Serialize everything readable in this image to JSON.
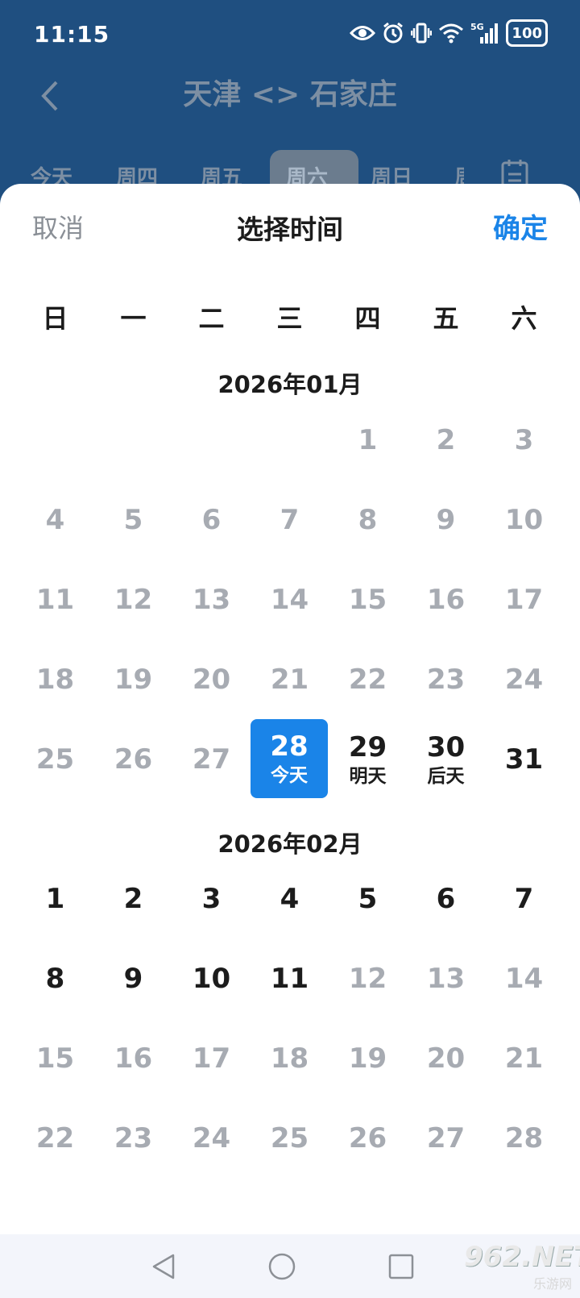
{
  "status_bar": {
    "time": "11:15",
    "signal_label": "5G",
    "battery": "100",
    "icons": [
      "eye-icon",
      "alarm-icon",
      "vibrate-icon",
      "wifi-icon",
      "signal-icon",
      "battery-icon"
    ]
  },
  "background": {
    "title": "天津 <> 石家庄",
    "tabs": [
      "今天",
      "周四",
      "周五",
      "周六",
      "周日",
      "周"
    ],
    "active_tab": "周六",
    "colors": {
      "header_bg": "#1f4f80"
    }
  },
  "sheet": {
    "cancel_label": "取消",
    "title": "选择时间",
    "confirm_label": "确定",
    "weekdays": [
      "日",
      "一",
      "二",
      "三",
      "四",
      "五",
      "六"
    ],
    "months": [
      {
        "title": "2026年01月",
        "days": [
          {
            "n": "",
            "s": "",
            "state": "empty"
          },
          {
            "n": "",
            "s": "",
            "state": "empty"
          },
          {
            "n": "",
            "s": "",
            "state": "empty"
          },
          {
            "n": "",
            "s": "",
            "state": "empty"
          },
          {
            "n": "1",
            "s": "",
            "state": "disabled"
          },
          {
            "n": "2",
            "s": "",
            "state": "disabled"
          },
          {
            "n": "3",
            "s": "",
            "state": "disabled"
          },
          {
            "n": "4",
            "s": "",
            "state": "disabled"
          },
          {
            "n": "5",
            "s": "",
            "state": "disabled"
          },
          {
            "n": "6",
            "s": "",
            "state": "disabled"
          },
          {
            "n": "7",
            "s": "",
            "state": "disabled"
          },
          {
            "n": "8",
            "s": "",
            "state": "disabled"
          },
          {
            "n": "9",
            "s": "",
            "state": "disabled"
          },
          {
            "n": "10",
            "s": "",
            "state": "disabled"
          },
          {
            "n": "11",
            "s": "",
            "state": "disabled"
          },
          {
            "n": "12",
            "s": "",
            "state": "disabled"
          },
          {
            "n": "13",
            "s": "",
            "state": "disabled"
          },
          {
            "n": "14",
            "s": "",
            "state": "disabled"
          },
          {
            "n": "15",
            "s": "",
            "state": "disabled"
          },
          {
            "n": "16",
            "s": "",
            "state": "disabled"
          },
          {
            "n": "17",
            "s": "",
            "state": "disabled"
          },
          {
            "n": "18",
            "s": "",
            "state": "disabled"
          },
          {
            "n": "19",
            "s": "",
            "state": "disabled"
          },
          {
            "n": "20",
            "s": "",
            "state": "disabled"
          },
          {
            "n": "21",
            "s": "",
            "state": "disabled"
          },
          {
            "n": "22",
            "s": "",
            "state": "disabled"
          },
          {
            "n": "23",
            "s": "",
            "state": "disabled"
          },
          {
            "n": "24",
            "s": "",
            "state": "disabled"
          },
          {
            "n": "25",
            "s": "",
            "state": "disabled"
          },
          {
            "n": "26",
            "s": "",
            "state": "disabled"
          },
          {
            "n": "27",
            "s": "",
            "state": "disabled"
          },
          {
            "n": "28",
            "s": "今天",
            "state": "selected"
          },
          {
            "n": "29",
            "s": "明天",
            "state": "enabled"
          },
          {
            "n": "30",
            "s": "后天",
            "state": "enabled"
          },
          {
            "n": "31",
            "s": "",
            "state": "enabled"
          }
        ]
      },
      {
        "title": "2026年02月",
        "days": [
          {
            "n": "1",
            "s": "",
            "state": "enabled"
          },
          {
            "n": "2",
            "s": "",
            "state": "enabled"
          },
          {
            "n": "3",
            "s": "",
            "state": "enabled"
          },
          {
            "n": "4",
            "s": "",
            "state": "enabled"
          },
          {
            "n": "5",
            "s": "",
            "state": "enabled"
          },
          {
            "n": "6",
            "s": "",
            "state": "enabled"
          },
          {
            "n": "7",
            "s": "",
            "state": "enabled"
          },
          {
            "n": "8",
            "s": "",
            "state": "enabled"
          },
          {
            "n": "9",
            "s": "",
            "state": "enabled"
          },
          {
            "n": "10",
            "s": "",
            "state": "enabled"
          },
          {
            "n": "11",
            "s": "",
            "state": "enabled"
          },
          {
            "n": "12",
            "s": "",
            "state": "disabled"
          },
          {
            "n": "13",
            "s": "",
            "state": "disabled"
          },
          {
            "n": "14",
            "s": "",
            "state": "disabled"
          },
          {
            "n": "15",
            "s": "",
            "state": "disabled"
          },
          {
            "n": "16",
            "s": "",
            "state": "disabled"
          },
          {
            "n": "17",
            "s": "",
            "state": "disabled"
          },
          {
            "n": "18",
            "s": "",
            "state": "disabled"
          },
          {
            "n": "19",
            "s": "",
            "state": "disabled"
          },
          {
            "n": "20",
            "s": "",
            "state": "disabled"
          },
          {
            "n": "21",
            "s": "",
            "state": "disabled"
          },
          {
            "n": "22",
            "s": "",
            "state": "disabled"
          },
          {
            "n": "23",
            "s": "",
            "state": "disabled"
          },
          {
            "n": "24",
            "s": "",
            "state": "disabled"
          },
          {
            "n": "25",
            "s": "",
            "state": "disabled"
          },
          {
            "n": "26",
            "s": "",
            "state": "disabled"
          },
          {
            "n": "27",
            "s": "",
            "state": "disabled"
          },
          {
            "n": "28",
            "s": "",
            "state": "disabled"
          }
        ]
      }
    ],
    "colors": {
      "accent": "#1a84e8",
      "disabled": "#a7abb2",
      "text": "#1c1c1c"
    }
  },
  "navbar": {
    "buttons": [
      "back-triangle-icon",
      "home-circle-icon",
      "recents-square-icon"
    ]
  },
  "watermark": {
    "main": "962.NET",
    "sub": "乐游网"
  }
}
